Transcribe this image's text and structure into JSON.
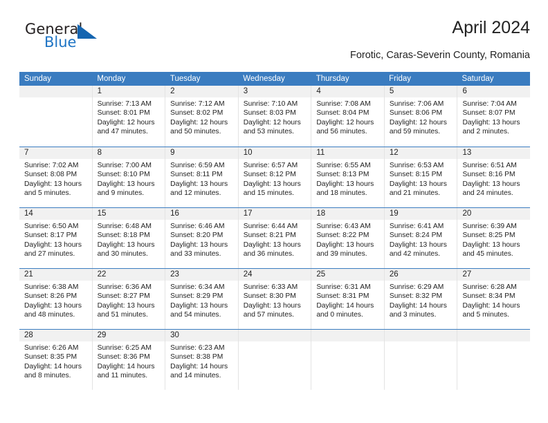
{
  "brand": {
    "name_top": "General",
    "name_bottom": "Blue",
    "accent_color": "#1565b0",
    "text_color": "#231f20"
  },
  "header": {
    "title": "April 2024",
    "subtitle": "Forotic, Caras-Severin County, Romania"
  },
  "theme": {
    "header_row_bg": "#3a7cc0",
    "daynum_bg": "#f1f1f1",
    "grid_line": "#e3e3e3",
    "text": "#222222"
  },
  "calendar": {
    "weekday_headers": [
      "Sunday",
      "Monday",
      "Tuesday",
      "Wednesday",
      "Thursday",
      "Friday",
      "Saturday"
    ],
    "weeks": [
      [
        {
          "day": "",
          "sunrise": "",
          "sunset": "",
          "daylight_line1": "",
          "daylight_line2": ""
        },
        {
          "day": "1",
          "sunrise": "Sunrise: 7:13 AM",
          "sunset": "Sunset: 8:01 PM",
          "daylight_line1": "Daylight: 12 hours",
          "daylight_line2": "and 47 minutes."
        },
        {
          "day": "2",
          "sunrise": "Sunrise: 7:12 AM",
          "sunset": "Sunset: 8:02 PM",
          "daylight_line1": "Daylight: 12 hours",
          "daylight_line2": "and 50 minutes."
        },
        {
          "day": "3",
          "sunrise": "Sunrise: 7:10 AM",
          "sunset": "Sunset: 8:03 PM",
          "daylight_line1": "Daylight: 12 hours",
          "daylight_line2": "and 53 minutes."
        },
        {
          "day": "4",
          "sunrise": "Sunrise: 7:08 AM",
          "sunset": "Sunset: 8:04 PM",
          "daylight_line1": "Daylight: 12 hours",
          "daylight_line2": "and 56 minutes."
        },
        {
          "day": "5",
          "sunrise": "Sunrise: 7:06 AM",
          "sunset": "Sunset: 8:06 PM",
          "daylight_line1": "Daylight: 12 hours",
          "daylight_line2": "and 59 minutes."
        },
        {
          "day": "6",
          "sunrise": "Sunrise: 7:04 AM",
          "sunset": "Sunset: 8:07 PM",
          "daylight_line1": "Daylight: 13 hours",
          "daylight_line2": "and 2 minutes."
        }
      ],
      [
        {
          "day": "7",
          "sunrise": "Sunrise: 7:02 AM",
          "sunset": "Sunset: 8:08 PM",
          "daylight_line1": "Daylight: 13 hours",
          "daylight_line2": "and 5 minutes."
        },
        {
          "day": "8",
          "sunrise": "Sunrise: 7:00 AM",
          "sunset": "Sunset: 8:10 PM",
          "daylight_line1": "Daylight: 13 hours",
          "daylight_line2": "and 9 minutes."
        },
        {
          "day": "9",
          "sunrise": "Sunrise: 6:59 AM",
          "sunset": "Sunset: 8:11 PM",
          "daylight_line1": "Daylight: 13 hours",
          "daylight_line2": "and 12 minutes."
        },
        {
          "day": "10",
          "sunrise": "Sunrise: 6:57 AM",
          "sunset": "Sunset: 8:12 PM",
          "daylight_line1": "Daylight: 13 hours",
          "daylight_line2": "and 15 minutes."
        },
        {
          "day": "11",
          "sunrise": "Sunrise: 6:55 AM",
          "sunset": "Sunset: 8:13 PM",
          "daylight_line1": "Daylight: 13 hours",
          "daylight_line2": "and 18 minutes."
        },
        {
          "day": "12",
          "sunrise": "Sunrise: 6:53 AM",
          "sunset": "Sunset: 8:15 PM",
          "daylight_line1": "Daylight: 13 hours",
          "daylight_line2": "and 21 minutes."
        },
        {
          "day": "13",
          "sunrise": "Sunrise: 6:51 AM",
          "sunset": "Sunset: 8:16 PM",
          "daylight_line1": "Daylight: 13 hours",
          "daylight_line2": "and 24 minutes."
        }
      ],
      [
        {
          "day": "14",
          "sunrise": "Sunrise: 6:50 AM",
          "sunset": "Sunset: 8:17 PM",
          "daylight_line1": "Daylight: 13 hours",
          "daylight_line2": "and 27 minutes."
        },
        {
          "day": "15",
          "sunrise": "Sunrise: 6:48 AM",
          "sunset": "Sunset: 8:18 PM",
          "daylight_line1": "Daylight: 13 hours",
          "daylight_line2": "and 30 minutes."
        },
        {
          "day": "16",
          "sunrise": "Sunrise: 6:46 AM",
          "sunset": "Sunset: 8:20 PM",
          "daylight_line1": "Daylight: 13 hours",
          "daylight_line2": "and 33 minutes."
        },
        {
          "day": "17",
          "sunrise": "Sunrise: 6:44 AM",
          "sunset": "Sunset: 8:21 PM",
          "daylight_line1": "Daylight: 13 hours",
          "daylight_line2": "and 36 minutes."
        },
        {
          "day": "18",
          "sunrise": "Sunrise: 6:43 AM",
          "sunset": "Sunset: 8:22 PM",
          "daylight_line1": "Daylight: 13 hours",
          "daylight_line2": "and 39 minutes."
        },
        {
          "day": "19",
          "sunrise": "Sunrise: 6:41 AM",
          "sunset": "Sunset: 8:24 PM",
          "daylight_line1": "Daylight: 13 hours",
          "daylight_line2": "and 42 minutes."
        },
        {
          "day": "20",
          "sunrise": "Sunrise: 6:39 AM",
          "sunset": "Sunset: 8:25 PM",
          "daylight_line1": "Daylight: 13 hours",
          "daylight_line2": "and 45 minutes."
        }
      ],
      [
        {
          "day": "21",
          "sunrise": "Sunrise: 6:38 AM",
          "sunset": "Sunset: 8:26 PM",
          "daylight_line1": "Daylight: 13 hours",
          "daylight_line2": "and 48 minutes."
        },
        {
          "day": "22",
          "sunrise": "Sunrise: 6:36 AM",
          "sunset": "Sunset: 8:27 PM",
          "daylight_line1": "Daylight: 13 hours",
          "daylight_line2": "and 51 minutes."
        },
        {
          "day": "23",
          "sunrise": "Sunrise: 6:34 AM",
          "sunset": "Sunset: 8:29 PM",
          "daylight_line1": "Daylight: 13 hours",
          "daylight_line2": "and 54 minutes."
        },
        {
          "day": "24",
          "sunrise": "Sunrise: 6:33 AM",
          "sunset": "Sunset: 8:30 PM",
          "daylight_line1": "Daylight: 13 hours",
          "daylight_line2": "and 57 minutes."
        },
        {
          "day": "25",
          "sunrise": "Sunrise: 6:31 AM",
          "sunset": "Sunset: 8:31 PM",
          "daylight_line1": "Daylight: 14 hours",
          "daylight_line2": "and 0 minutes."
        },
        {
          "day": "26",
          "sunrise": "Sunrise: 6:29 AM",
          "sunset": "Sunset: 8:32 PM",
          "daylight_line1": "Daylight: 14 hours",
          "daylight_line2": "and 3 minutes."
        },
        {
          "day": "27",
          "sunrise": "Sunrise: 6:28 AM",
          "sunset": "Sunset: 8:34 PM",
          "daylight_line1": "Daylight: 14 hours",
          "daylight_line2": "and 5 minutes."
        }
      ],
      [
        {
          "day": "28",
          "sunrise": "Sunrise: 6:26 AM",
          "sunset": "Sunset: 8:35 PM",
          "daylight_line1": "Daylight: 14 hours",
          "daylight_line2": "and 8 minutes."
        },
        {
          "day": "29",
          "sunrise": "Sunrise: 6:25 AM",
          "sunset": "Sunset: 8:36 PM",
          "daylight_line1": "Daylight: 14 hours",
          "daylight_line2": "and 11 minutes."
        },
        {
          "day": "30",
          "sunrise": "Sunrise: 6:23 AM",
          "sunset": "Sunset: 8:38 PM",
          "daylight_line1": "Daylight: 14 hours",
          "daylight_line2": "and 14 minutes."
        },
        {
          "day": "",
          "sunrise": "",
          "sunset": "",
          "daylight_line1": "",
          "daylight_line2": ""
        },
        {
          "day": "",
          "sunrise": "",
          "sunset": "",
          "daylight_line1": "",
          "daylight_line2": ""
        },
        {
          "day": "",
          "sunrise": "",
          "sunset": "",
          "daylight_line1": "",
          "daylight_line2": ""
        },
        {
          "day": "",
          "sunrise": "",
          "sunset": "",
          "daylight_line1": "",
          "daylight_line2": ""
        }
      ]
    ]
  }
}
